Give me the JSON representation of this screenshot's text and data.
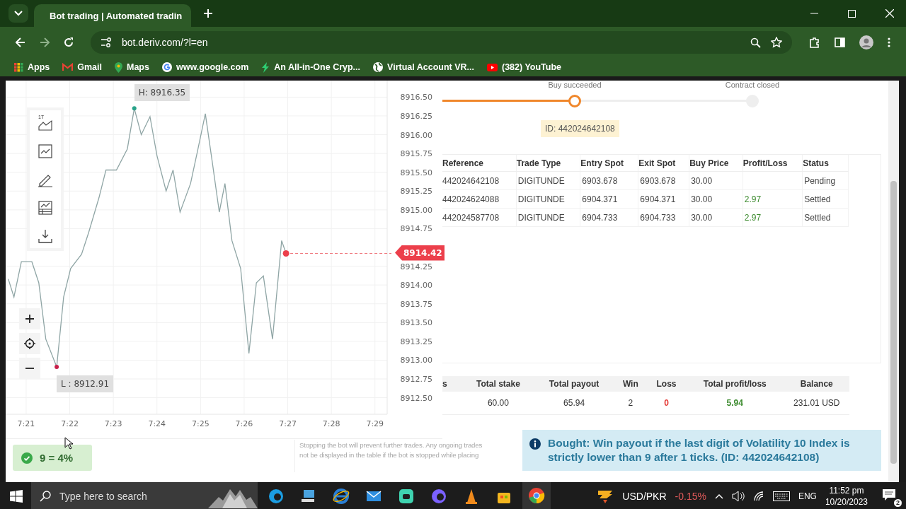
{
  "browser": {
    "tab": {
      "title": "Bot trading | Automated tradin",
      "selected": true
    },
    "url": "bot.deriv.com/?l=en",
    "bookmarks": [
      {
        "label": "Apps",
        "kind": "apps"
      },
      {
        "label": "Gmail",
        "kind": "mail"
      },
      {
        "label": "Maps",
        "kind": "maps"
      },
      {
        "label": "www.google.com",
        "kind": "google"
      },
      {
        "label": "An All-in-One Cryp...",
        "kind": "bolt"
      },
      {
        "label": "Virtual Account VR...",
        "kind": "globe"
      },
      {
        "label": "(382) YouTube",
        "kind": "video"
      }
    ]
  },
  "chart": {
    "toolbar_label": "1T",
    "high_label": "H: 8916.35",
    "low_label": "L : 8912.91",
    "current_price": "8914.42",
    "chart_data": {
      "type": "line",
      "x": [
        440.59,
        440.72,
        440.89,
        441.13,
        441.29,
        441.45,
        441.7,
        441.86,
        442.02,
        442.27,
        442.43,
        442.67,
        442.83,
        443.07,
        443.32,
        443.48,
        443.64,
        443.84,
        444.0,
        444.21,
        444.37,
        444.53,
        444.77,
        444.94,
        445.11,
        445.27,
        445.43,
        445.56,
        445.72,
        445.92,
        446.11,
        446.28,
        446.44,
        446.65,
        446.86,
        446.96
      ],
      "series": [
        {
          "color": "#8fa5a5",
          "values": [
            8914.08,
            8913.84,
            8914.31,
            8914.31,
            8914.03,
            8913.28,
            8912.91,
            8913.84,
            8914.22,
            8914.41,
            8914.69,
            8915.16,
            8915.53,
            8915.53,
            8915.81,
            8916.35,
            8916.0,
            8916.24,
            8915.72,
            8915.25,
            8915.53,
            8914.97,
            8915.35,
            8915.81,
            8916.28,
            8915.63,
            8914.97,
            8915.35,
            8914.59,
            8914.22,
            8913.09,
            8914.03,
            8914.12,
            8913.28,
            8914.59,
            8914.42
          ]
        }
      ],
      "grid": true,
      "ref_lines": [
        {
          "axis": "y",
          "value": 8914.42,
          "color": "#f07a80"
        }
      ],
      "xlim": [
        440.53,
        449.28
      ],
      "ylim": [
        8912.28,
        8916.72
      ],
      "xticks": [
        {
          "value": 441,
          "label": "7:21"
        },
        {
          "value": 442,
          "label": "7:22"
        },
        {
          "value": 443,
          "label": "7:23"
        },
        {
          "value": 444,
          "label": "7:24"
        },
        {
          "value": 445,
          "label": "7:25"
        },
        {
          "value": 446,
          "label": "7:26"
        },
        {
          "value": 447,
          "label": "7:27"
        },
        {
          "value": 448,
          "label": "7:28"
        },
        {
          "value": 449,
          "label": "7:29"
        }
      ],
      "yticks": [
        {
          "value": 8912.5,
          "label": "8912.50"
        },
        {
          "value": 8912.75,
          "label": "8912.75"
        },
        {
          "value": 8913,
          "label": "8913.00"
        },
        {
          "value": 8913.25,
          "label": "8913.25"
        },
        {
          "value": 8913.5,
          "label": "8913.50"
        },
        {
          "value": 8913.75,
          "label": "8913.75"
        },
        {
          "value": 8914,
          "label": "8914.00"
        },
        {
          "value": 8914.25,
          "label": "8914.25"
        },
        {
          "value": 8914.75,
          "label": "8914.75"
        },
        {
          "value": 8915,
          "label": "8915.00"
        },
        {
          "value": 8915.25,
          "label": "8915.25"
        },
        {
          "value": 8915.5,
          "label": "8915.50"
        },
        {
          "value": 8915.75,
          "label": "8915.75"
        },
        {
          "value": 8916,
          "label": "8916.00"
        },
        {
          "value": 8916.25,
          "label": "8916.25"
        },
        {
          "value": 8916.5,
          "label": "8916.50"
        }
      ]
    }
  },
  "progress": {
    "steps": [
      {
        "label": "Buy succeeded",
        "done": true
      },
      {
        "label": "Contract closed",
        "done": false
      }
    ],
    "contract_id": "ID: 442024642108"
  },
  "trades": {
    "columns": [
      "Reference",
      "Trade Type",
      "Entry Spot",
      "Exit Spot",
      "Buy Price",
      "Profit/Loss",
      "Status"
    ],
    "rows": [
      {
        "reference": "442024642108",
        "trade_type": "DIGITUNDE",
        "entry_spot": "6903.678",
        "exit_spot": "6903.678",
        "buy_price": "30.00",
        "status": "Pending"
      },
      {
        "reference": "442024624088",
        "trade_type": "DIGITUNDE",
        "entry_spot": "6904.371",
        "exit_spot": "6904.371",
        "buy_price": "30.00",
        "profit_loss": "2.97",
        "status": "Settled"
      },
      {
        "reference": "442024587708",
        "trade_type": "DIGITUNDE",
        "entry_spot": "6904.733",
        "exit_spot": "6904.733",
        "buy_price": "30.00",
        "profit_loss": "2.97",
        "status": "Settled"
      }
    ]
  },
  "summary": {
    "columns": [
      {
        "header": "s"
      },
      {
        "header": "Total stake",
        "value": "60.00"
      },
      {
        "header": "Total payout",
        "value": "65.94"
      },
      {
        "header": "Win",
        "value": "2"
      },
      {
        "header": "Loss",
        "value": "0",
        "color": "#e53935"
      },
      {
        "header": "Total profit/loss",
        "value": "5.94",
        "color": "#3d8b2f"
      },
      {
        "header": "Balance",
        "value": "231.01 USD"
      }
    ]
  },
  "note": [
    "Stopping the bot will prevent further trades. Any ongoing trades",
    "not be displayed in the table if the bot is stopped while placing"
  ],
  "notification": {
    "text": "Bought: Win payout if the last digit of Volatility 10 Index is strictly lower than 9 after 1 ticks. (ID: 442024642108)"
  },
  "toast": {
    "text": "9 = 4%"
  },
  "taskbar": {
    "search_placeholder": "Type here to search",
    "pinned": [
      {
        "kind": "edge",
        "selected": false
      },
      {
        "kind": "computer",
        "selected": false
      },
      {
        "kind": "ie",
        "selected": false
      },
      {
        "kind": "mail",
        "selected": false
      },
      {
        "kind": "chat",
        "selected": false
      },
      {
        "kind": "copilot",
        "selected": false
      },
      {
        "kind": "cone",
        "selected": false
      },
      {
        "kind": "store",
        "selected": false
      },
      {
        "kind": "chrome",
        "selected": true
      }
    ],
    "ticker": {
      "pair": "USD/PKR",
      "change": "-0.15%"
    },
    "language": "ENG",
    "time": "11:52 pm",
    "date": "10/20/2023",
    "notifications": "2"
  }
}
